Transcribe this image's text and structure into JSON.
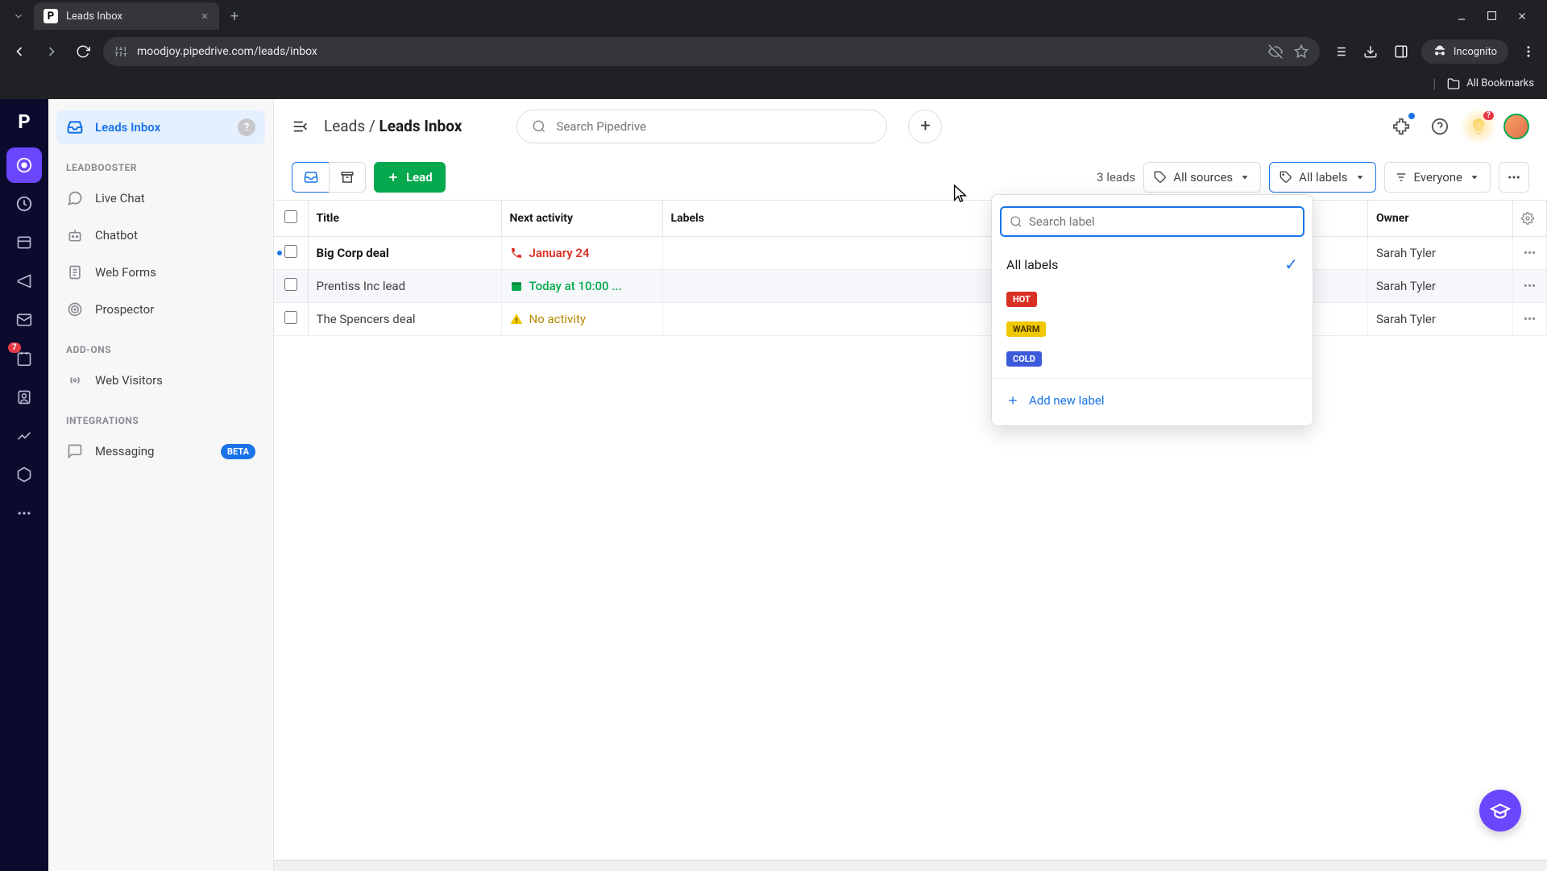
{
  "browser": {
    "tab_title": "Leads Inbox",
    "tab_favicon_letter": "P",
    "url": "moodjoy.pipedrive.com/leads/inbox",
    "incognito_label": "Incognito",
    "bookmarks_label": "All Bookmarks"
  },
  "rail": {
    "logo_letter": "P",
    "badge_value": "7"
  },
  "sidebar": {
    "active": {
      "label": "Leads Inbox",
      "info": "?"
    },
    "sections": [
      {
        "title": "LEADBOOSTER",
        "items": [
          {
            "label": "Live Chat"
          },
          {
            "label": "Chatbot"
          },
          {
            "label": "Web Forms"
          },
          {
            "label": "Prospector"
          }
        ]
      },
      {
        "title": "ADD-ONS",
        "items": [
          {
            "label": "Web Visitors"
          }
        ]
      },
      {
        "title": "INTEGRATIONS",
        "items": [
          {
            "label": "Messaging",
            "badge": "BETA"
          }
        ]
      }
    ]
  },
  "topbar": {
    "breadcrumb_root": "Leads",
    "breadcrumb_current": "Leads Inbox",
    "search_placeholder": "Search Pipedrive",
    "notif_count": "?"
  },
  "filterbar": {
    "lead_button": "Lead",
    "lead_count": "3 leads",
    "filters": {
      "sources": "All sources",
      "labels": "All labels",
      "owner": "Everyone"
    }
  },
  "table": {
    "columns": {
      "title": "Title",
      "next_activity": "Next activity",
      "labels": "Labels",
      "owner": "Owner"
    },
    "rows": [
      {
        "title": "Big Corp deal",
        "title_bold": true,
        "dot": true,
        "activity": {
          "text": "January 24",
          "kind": "overdue",
          "icon": "phone"
        },
        "owner": "Sarah Tyler"
      },
      {
        "title": "Prentiss Inc lead",
        "highlighted": true,
        "activity": {
          "text": "Today at 10:00 ...",
          "kind": "today",
          "icon": "calendar"
        },
        "owner": "Sarah Tyler"
      },
      {
        "title": "The Spencers deal",
        "activity": {
          "text": "No activity",
          "kind": "none",
          "icon": "warning"
        },
        "owner": "Sarah Tyler"
      }
    ]
  },
  "label_dropdown": {
    "search_placeholder": "Search label",
    "all_labels": "All labels",
    "labels": [
      {
        "text": "HOT",
        "color": "#d93025"
      },
      {
        "text": "WARM",
        "color": "#f0c800"
      },
      {
        "text": "COLD",
        "color": "#3b5bdb"
      }
    ],
    "add_new": "Add new label"
  }
}
